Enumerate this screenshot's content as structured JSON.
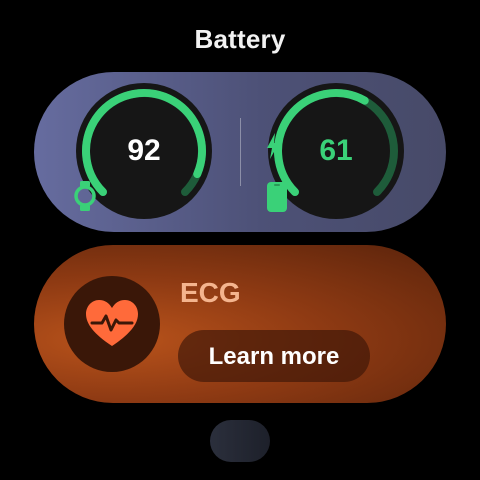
{
  "title": "Battery",
  "battery": {
    "watch": {
      "value": "92",
      "level_percent": 92,
      "charging": false,
      "icon": "watch-icon"
    },
    "phone": {
      "value": "61",
      "level_percent": 61,
      "charging": true,
      "icon": "phone-icon"
    },
    "colors": {
      "arc": "#3ad178",
      "track": "#1e5c3a",
      "ring_bg": "#161616"
    }
  },
  "ecg": {
    "label": "ECG",
    "button_label": "Learn more",
    "icon": "heart-ecg-icon",
    "accent": "#ff6a3a"
  }
}
